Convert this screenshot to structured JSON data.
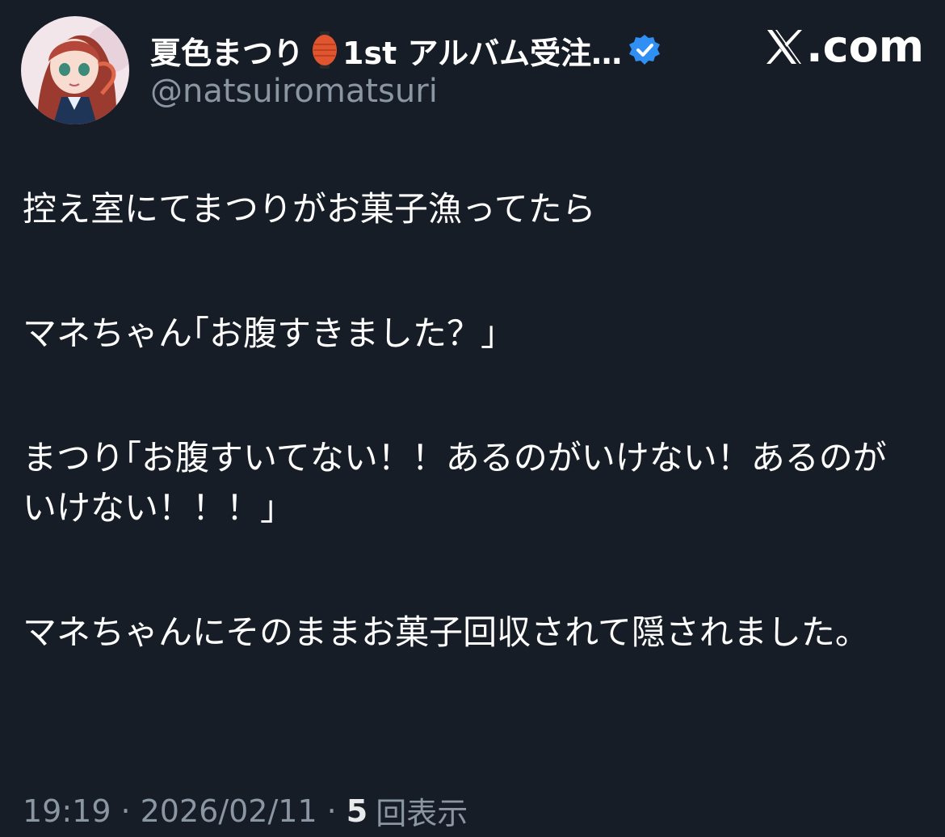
{
  "header": {
    "display_name": "夏色まつり",
    "name_suffix": "1st アルバム受注…",
    "handle": "@natsuiromatsuri",
    "lantern_icon": "paper-lantern-icon",
    "verified_icon": "verified-badge-icon",
    "verified_color": "#2f8ff2"
  },
  "brand": {
    "icon": "x-logo-icon",
    "label": ".com"
  },
  "post": {
    "paragraphs": [
      "控え室にてまつりがお菓子漁ってたら",
      "マネちゃん｢お腹すきました？」",
      "まつり｢お腹すいてない！！あるのがいけない！あるのがいけない！！！」",
      "マネちゃんにそのままお菓子回収されて隠されました。"
    ]
  },
  "footer": {
    "time": "19:19",
    "date": "2026/02/11",
    "views_count": "5",
    "views_label": "回表示"
  },
  "colors": {
    "background": "#171d27",
    "primary_text": "#ffffff",
    "secondary_text": "#8b96a3"
  }
}
